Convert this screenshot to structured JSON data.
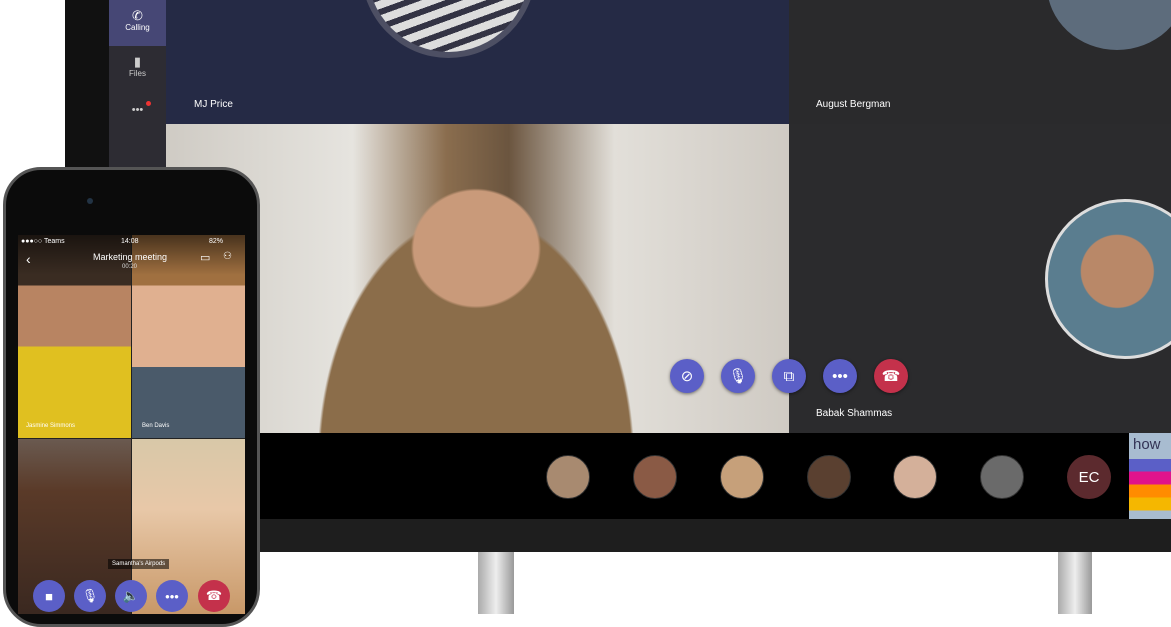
{
  "rail": {
    "items": [
      {
        "label": "Calling",
        "icon": "phone-icon",
        "active": true
      },
      {
        "label": "Files",
        "icon": "file-icon"
      },
      {
        "label": "•••",
        "icon": "more-icon",
        "badge": true
      }
    ]
  },
  "tiles": {
    "top_left": "MJ Price",
    "top_right": "August Bergman",
    "right": "Babak Shammas"
  },
  "controls": [
    {
      "name": "camera-off",
      "icon": "camera-off-icon"
    },
    {
      "name": "mic",
      "icon": "microphone-icon"
    },
    {
      "name": "share",
      "icon": "share-screen-icon"
    },
    {
      "name": "more",
      "icon": "more-icon"
    },
    {
      "name": "hang-up",
      "icon": "hang-up-icon"
    }
  ],
  "strip": {
    "initials": "EC",
    "share_preview_text": "how"
  },
  "phone": {
    "carrier": "●●●○○ Teams",
    "time": "14:08",
    "battery": "82%",
    "title": "Marketing meeting",
    "duration": "00:20",
    "participants": [
      "Jasmine Simmons",
      "Ben Davis",
      "",
      "Samantha's Airpods"
    ]
  },
  "colors": {
    "accent": "#5b5fc7",
    "hangup": "#c4314b",
    "rail_active": "#464775"
  }
}
